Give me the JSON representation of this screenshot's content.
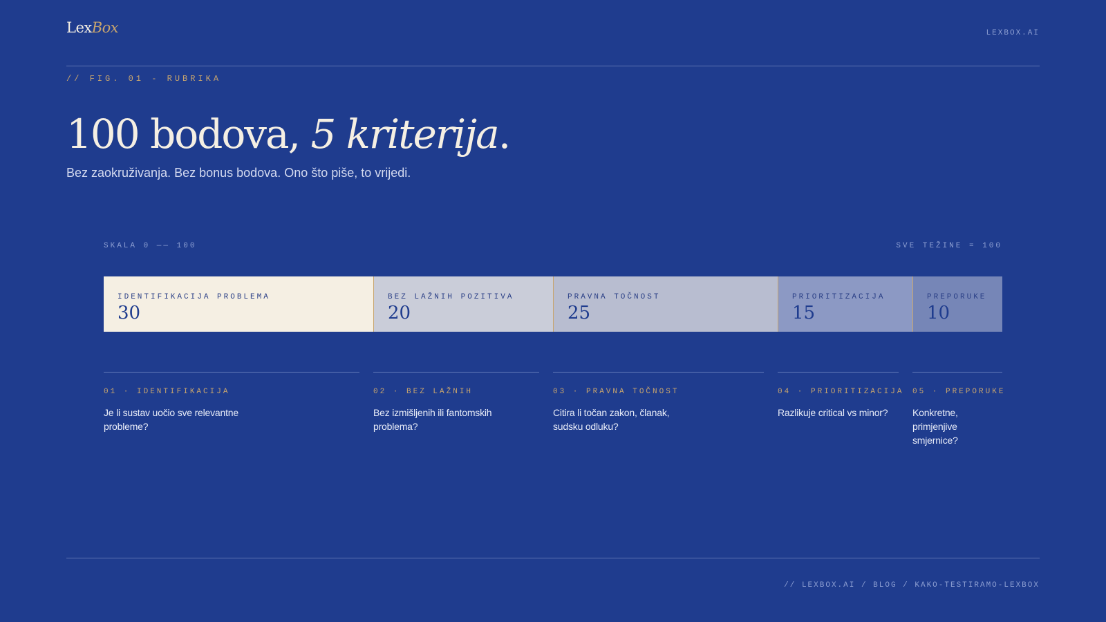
{
  "header": {
    "logo_main": "Lex",
    "logo_accent": "Box",
    "site": "LEXBOX.AI"
  },
  "figure_label": "// FIG. 01 - RUBRIKA",
  "title": {
    "main": "100 bodova, ",
    "emphasis": "5 kriterija",
    "end": "."
  },
  "subtitle": "Bez zaokruživanja. Bez bonus bodova. Ono što piše, to vrijedi.",
  "scale": {
    "left": "SKALA 0 —— 100",
    "right": "SVE TEŽINE = 100"
  },
  "chart_data": {
    "type": "bar",
    "orientation": "horizontal-stacked",
    "total": 100,
    "categories": [
      "IDENTIFIKACIJA PROBLEMA",
      "BEZ LAŽNIH POZITIVA",
      "PRAVNA TOČNOST",
      "PRIORITIZACIJA",
      "PREPORUKE"
    ],
    "values": [
      30,
      20,
      25,
      15,
      10
    ],
    "colors": [
      "#f5efe3",
      "#cacdd9",
      "#b8bdd0",
      "#8c99c4",
      "#7686b7"
    ]
  },
  "criteria": [
    {
      "label": "01 · IDENTIFIKACIJA",
      "text": "Je li sustav uočio sve relevantne probleme?"
    },
    {
      "label": "02 · BEZ LAŽNIH",
      "text": "Bez izmišljenih ili fantomskih problema?"
    },
    {
      "label": "03 · PRAVNA TOČNOST",
      "text": "Citira li točan zakon, članak, sudsku odluku?"
    },
    {
      "label": "04 · PRIORITIZACIJA",
      "text": "Razlikuje critical vs minor?"
    },
    {
      "label": "05 · PREPORUKE",
      "text": "Konkretne, primjenjive smjernice?"
    }
  ],
  "footer": {
    "path": "// LEXBOX.AI / BLOG / KAKO-TESTIRAMO-LEXBOX"
  }
}
